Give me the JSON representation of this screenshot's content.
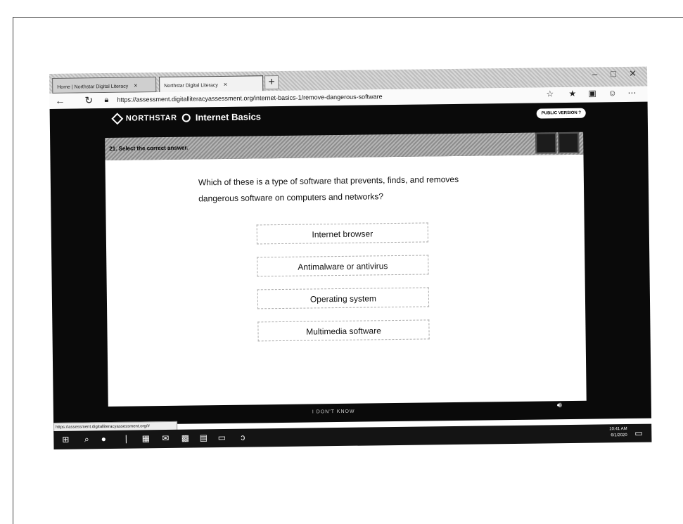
{
  "browser": {
    "tabs": [
      {
        "label": "Home | Northstar Digital Literacy"
      },
      {
        "label": "Northstar Digital Literacy"
      }
    ],
    "url": "https://assessment.digitalliteracyassessment.org/internet-basics-1/remove-dangerous-software",
    "status_url": "https://assessment.digitalliteracyassessment.org/#"
  },
  "app": {
    "brand": "NORTHSTAR",
    "module": "Internet Basics",
    "public_badge": "PUBLIC VERSION"
  },
  "question": {
    "number_prompt": "21. Select the correct answer.",
    "text": "Which of these is a type of software that prevents, finds, and removes dangerous software on computers and networks?",
    "options": [
      {
        "label": "Internet browser"
      },
      {
        "label": "Antimalware or antivirus"
      },
      {
        "label": "Operating system"
      },
      {
        "label": "Multimedia software"
      }
    ]
  },
  "footer": {
    "text": "I DON'T KNOW"
  },
  "taskbar": {
    "time": "10:41 AM",
    "date": "6/1/2020"
  }
}
